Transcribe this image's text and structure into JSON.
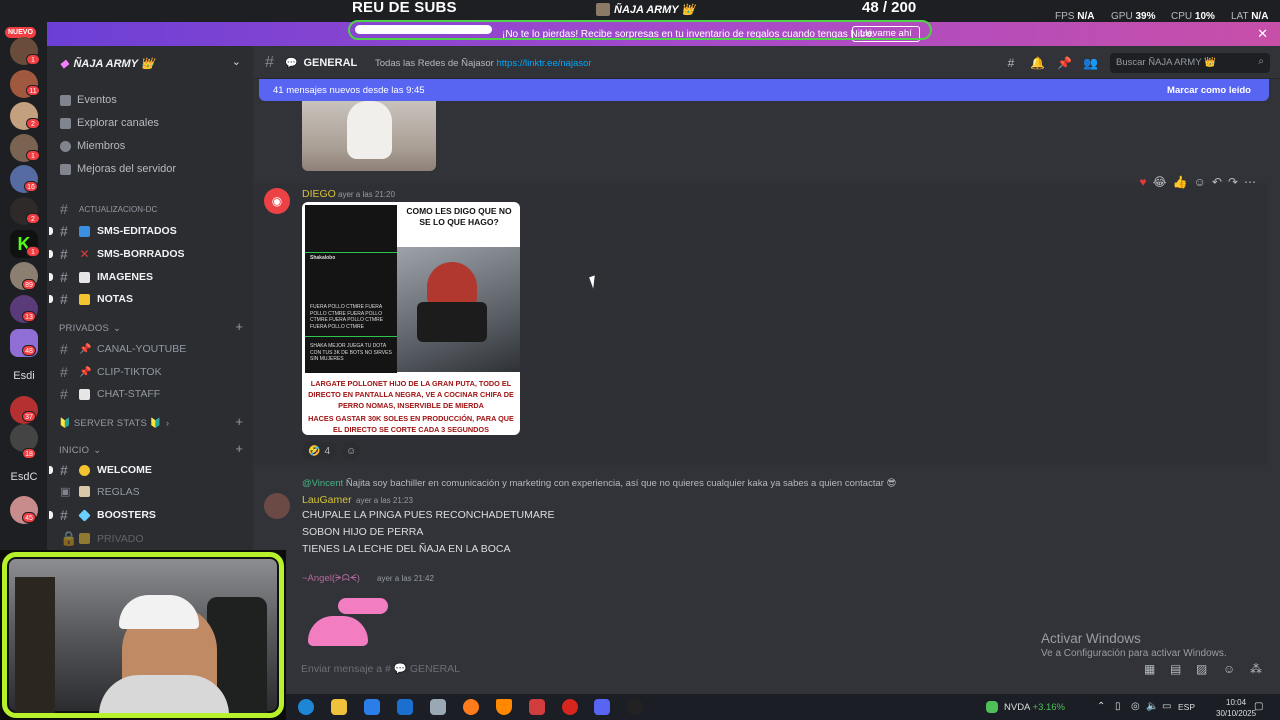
{
  "overlay": {
    "goal_title": "REU DE SUBS",
    "goal_server": "ÑAJA ARMY 👑",
    "goal_count": "48  / 200",
    "goal_progress": 0.24,
    "fps_label": "FPS",
    "fps_value": "N/A",
    "gpu_label": "GPU",
    "gpu_value": "39%",
    "cpu_label": "CPU",
    "cpu_value": "10%",
    "lat_label": "LAT",
    "lat_value": "N/A"
  },
  "nitro_banner": {
    "text": "¡No te lo pierdas! Recibe sorpresas en tu inventario de regalos cuando tengas Nitro.",
    "button": "Llévame ahí",
    "close": "✕"
  },
  "rail": {
    "nuevo": "NUEVO",
    "badges": [
      "1",
      "11",
      "2",
      "1",
      "16",
      "2",
      "1",
      "89",
      "13",
      "48",
      "37",
      "18",
      "45"
    ],
    "text_items": [
      "Esdi",
      "EsdC"
    ]
  },
  "sidebar": {
    "server_name": "ÑAJA ARMY 👑",
    "links": [
      "Eventos",
      "Explorar canales",
      "Miembros",
      "Mejoras del servidor"
    ],
    "channels_top": [
      "ACTUALIZACION-DC",
      "SMS-EDITADOS",
      "SMS-BORRADOS",
      "IMAGENES",
      "NOTAS"
    ],
    "cat_privados": "PRIVADOS",
    "channels_priv": [
      "CANAL-YOUTUBE",
      "CLIP-TIKTOK",
      "CHAT-STAFF"
    ],
    "cat_stats": "🔰 SERVER STATS 🔰",
    "cat_inicio": "INICIO",
    "channels_inicio": [
      "WELCOME",
      "REGLAS",
      "BOOSTERS",
      "PRIVADO"
    ]
  },
  "header": {
    "channel": "GENERAL",
    "topic": "Todas las Redes de Ñajasor",
    "topic_link": "https://linktr.ee/najasor",
    "search_placeholder": "Buscar ÑAJA ARMY 👑"
  },
  "newbar": {
    "text": "41 mensajes nuevos desde las 9:45",
    "mark": "Marcar como leído"
  },
  "messages": [
    {
      "author": "DIEGO",
      "time": "ayer a las 21:20",
      "meme_caption": "COMO LES DIGO QUE NO SE LO QUE HAGO?",
      "meme_bottom_1": "LARGATE POLLONET HIJO DE LA GRAN PUTA, TODO EL DIRECTO EN PANTALLA NEGRA, VE A COCINAR CHIFA DE PERRO NOMAS, INSERVIBLE DE MIERDA",
      "meme_bottom_2": "HACES GASTAR 30K SOLES EN PRODUCCIÓN, PARA QUE EL DIRECTO SE CORTE CADA 3 SEGUNDOS",
      "phone_user": "Shakalobo",
      "phone_comment": "FUERA POLLO CTMRE FUERA POLLO CTMRE FUERA POLLO CTMRE FUERA POLLO CTMRE FUERA POLLO CTMRE",
      "phone_comment2": "SHAKA MEJOR JUEGA TU DOTA CON TUS 3K DE BOTS NO SIRVES SIN MUJERES",
      "reaction_count": "4"
    },
    {
      "reply_ref": "@Vincent",
      "reply_text": "Ñajita soy bachiller en comunicación y marketing con experiencia, así que no quieres cualquier kaka ya sabes a quien contactar 😎",
      "author": "LauGamer",
      "time": "ayer a las 21:23",
      "lines": [
        "CHUPALE LA PINGA PUES RECONCHADETUMARE",
        "SOBON HIJO DE PERRA",
        "TIENES LA LECHE DEL ÑAJA EN LA BOCA"
      ]
    },
    {
      "author": "~Angel(ᗒᗣᗕ)",
      "time": "ayer a las 21:42"
    }
  ],
  "composer": {
    "placeholder": "Enviar mensaje a #",
    "channel": "GENERAL"
  },
  "watermark": {
    "line1": "Activar Windows",
    "line2": "Ve a Configuración para activar Windows."
  },
  "taskbar": {
    "stock_name": "NVDA",
    "stock_change": "+3.16%",
    "lang": "ESP",
    "time": "10:04",
    "date": "30/10/2025"
  }
}
